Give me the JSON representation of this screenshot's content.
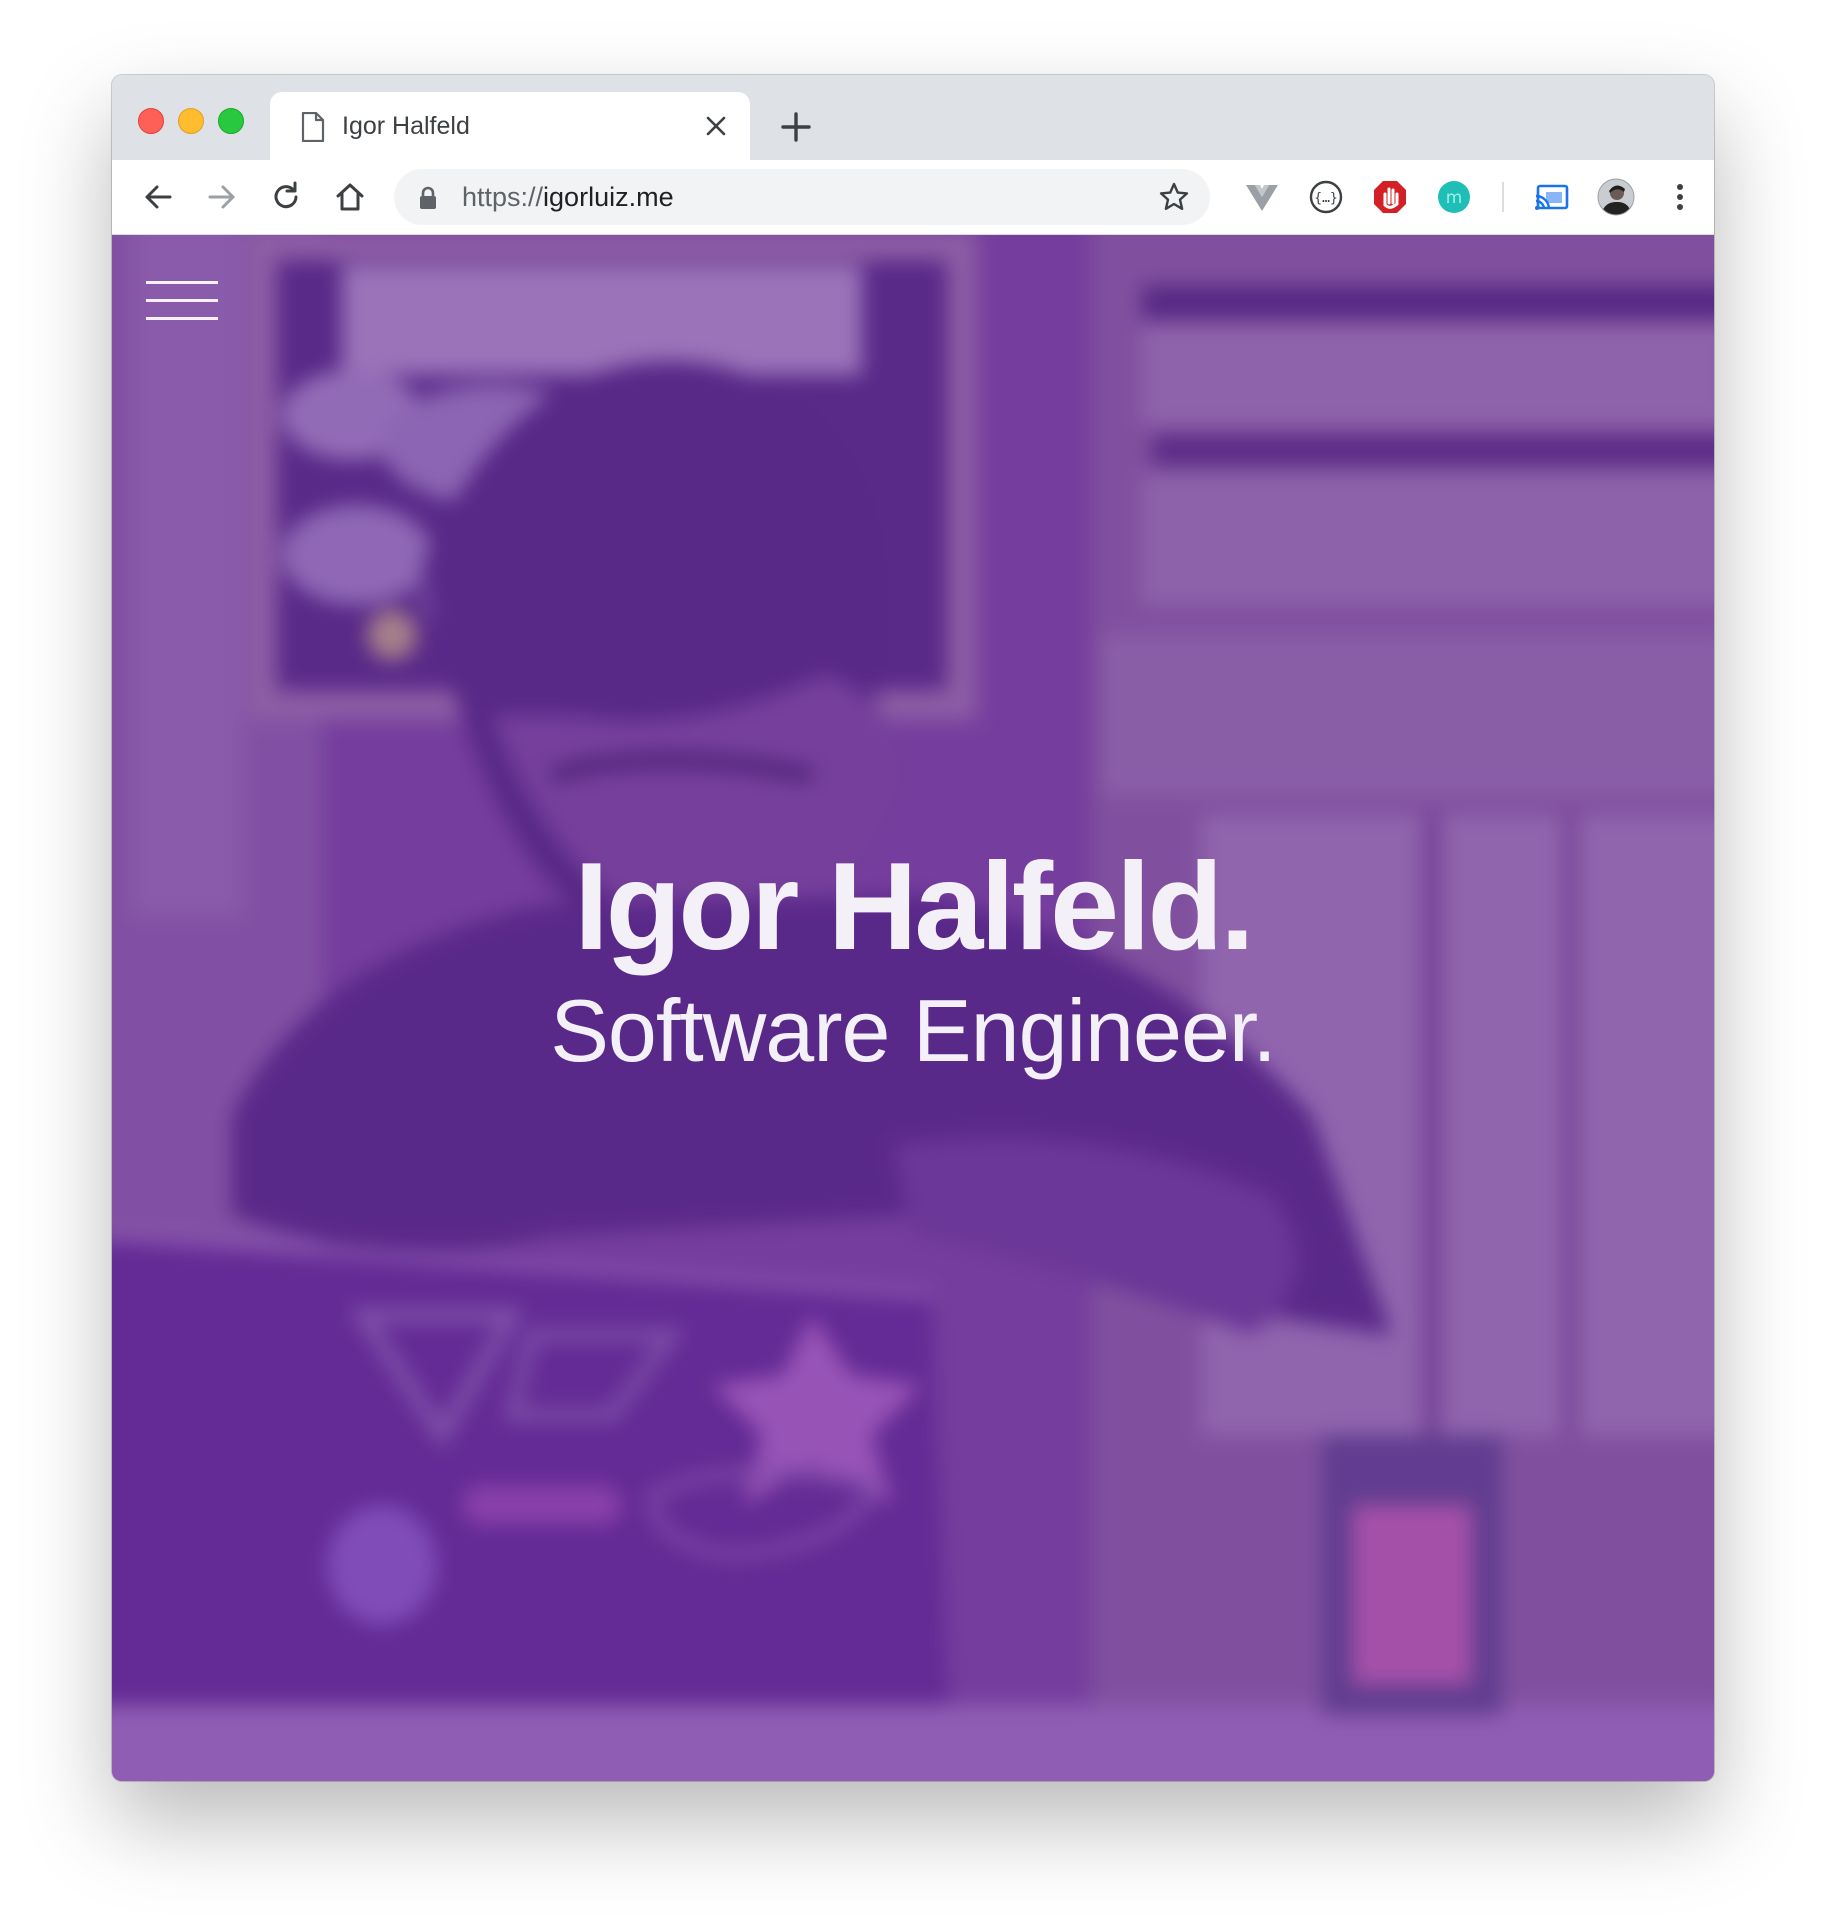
{
  "browser": {
    "tab": {
      "title": "Igor Halfeld",
      "icon": "page-icon"
    },
    "new_tab_icon": "plus-icon",
    "toolbar": {
      "back_icon": "arrow-left-icon",
      "forward_icon": "arrow-right-icon",
      "reload_icon": "reload-icon",
      "home_icon": "home-icon",
      "url_scheme": "https://",
      "url_host": "igorluiz.me",
      "bookmark_icon": "star-icon",
      "extensions": [
        "vue-devtools-icon",
        "json-formatter-icon",
        "adblock-icon",
        "m-extension-icon",
        "cast-icon"
      ],
      "profile_icon": "avatar",
      "menu_icon": "kebab-menu-icon"
    }
  },
  "page": {
    "menu_icon": "hamburger-icon",
    "hero": {
      "name": "Igor Halfeld.",
      "role": "Software Engineer."
    },
    "colors": {
      "overlay": "#6e28a0",
      "text": "#f4f0f8"
    }
  }
}
